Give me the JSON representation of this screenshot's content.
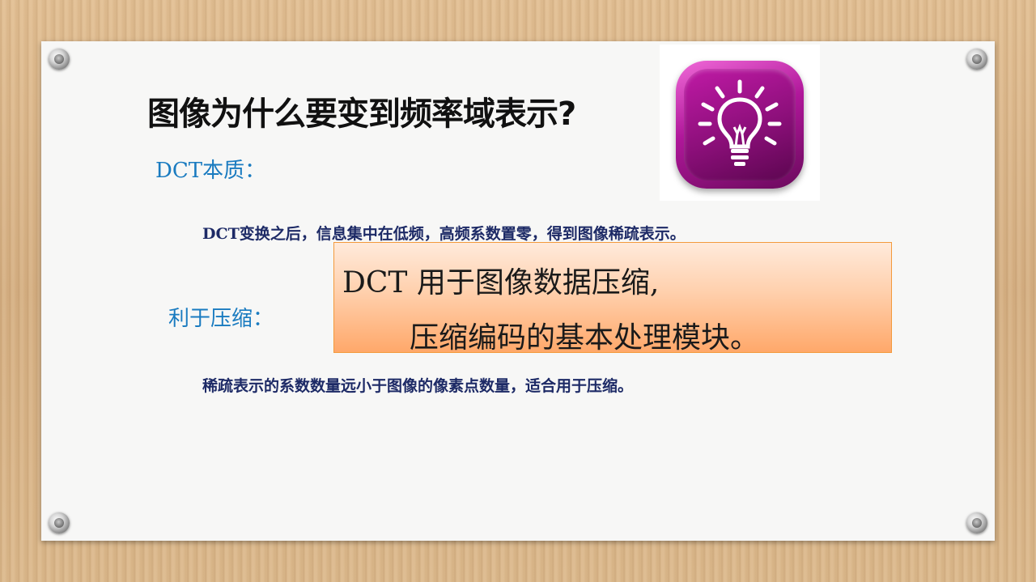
{
  "slide": {
    "title": "图像为什么要变到频率域表示?",
    "section_dct": {
      "heading": "DCT本质：",
      "text": "DCT变换之后，信息集中在低频，高频系数置零，得到图像稀疏表示。"
    },
    "section_compression": {
      "heading": "利于压缩：",
      "callout_line1": "DCT 用于图像数据压缩,",
      "callout_line2": "压缩编码的基本处理模块。",
      "text": "稀疏表示的系数数量远小于图像的像素点数量，适合用于压缩。"
    },
    "icon": "lightbulb-icon"
  },
  "colors": {
    "heading": "#1a7bc0",
    "body_text": "#1d2a66",
    "icon_tile": "#b0179a",
    "callout_border": "#f39a3c"
  }
}
